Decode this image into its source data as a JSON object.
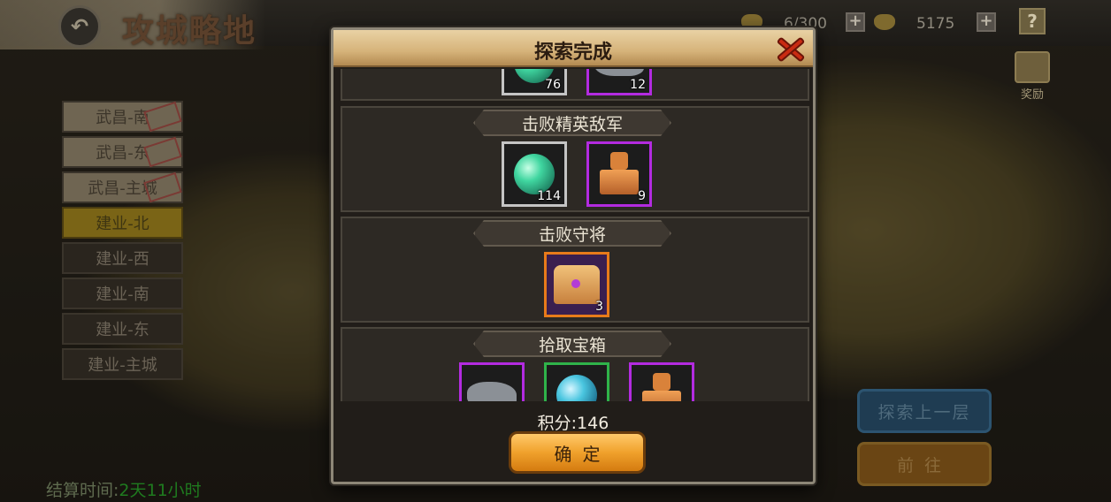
{
  "header": {
    "title": "攻城略地",
    "stamina": "6/300",
    "gold": "5175",
    "help": "?"
  },
  "reward": {
    "label": "奖励"
  },
  "side_list": {
    "items": [
      {
        "label": "武昌-南",
        "state": "done"
      },
      {
        "label": "武昌-东",
        "state": "done"
      },
      {
        "label": "武昌-主城",
        "state": "done"
      },
      {
        "label": "建业-北",
        "state": "active"
      },
      {
        "label": "建业-西",
        "state": "locked"
      },
      {
        "label": "建业-南",
        "state": "locked"
      },
      {
        "label": "建业-东",
        "state": "locked"
      },
      {
        "label": "建业-主城",
        "state": "locked"
      }
    ]
  },
  "settlement": {
    "label": "结算时间:",
    "value": "2天11小时"
  },
  "buttons": {
    "explore_up": "探索上一层",
    "go": "前往"
  },
  "modal": {
    "title": "探索完成",
    "sections": [
      {
        "title": "",
        "items": [
          {
            "type": "orb",
            "count": "76"
          },
          {
            "type": "beast",
            "count": "12"
          }
        ]
      },
      {
        "title": "击败精英敌军",
        "items": [
          {
            "type": "orb",
            "count": "114"
          },
          {
            "type": "seal",
            "count": "9"
          }
        ]
      },
      {
        "title": "击败守将",
        "items": [
          {
            "type": "chest",
            "count": "3"
          }
        ]
      },
      {
        "title": "拾取宝箱",
        "items": [
          {
            "type": "beast",
            "count": ""
          },
          {
            "type": "orb-blue",
            "count": ""
          },
          {
            "type": "seal",
            "count": ""
          }
        ]
      }
    ],
    "score_label": "积分:146",
    "confirm": "确定"
  }
}
